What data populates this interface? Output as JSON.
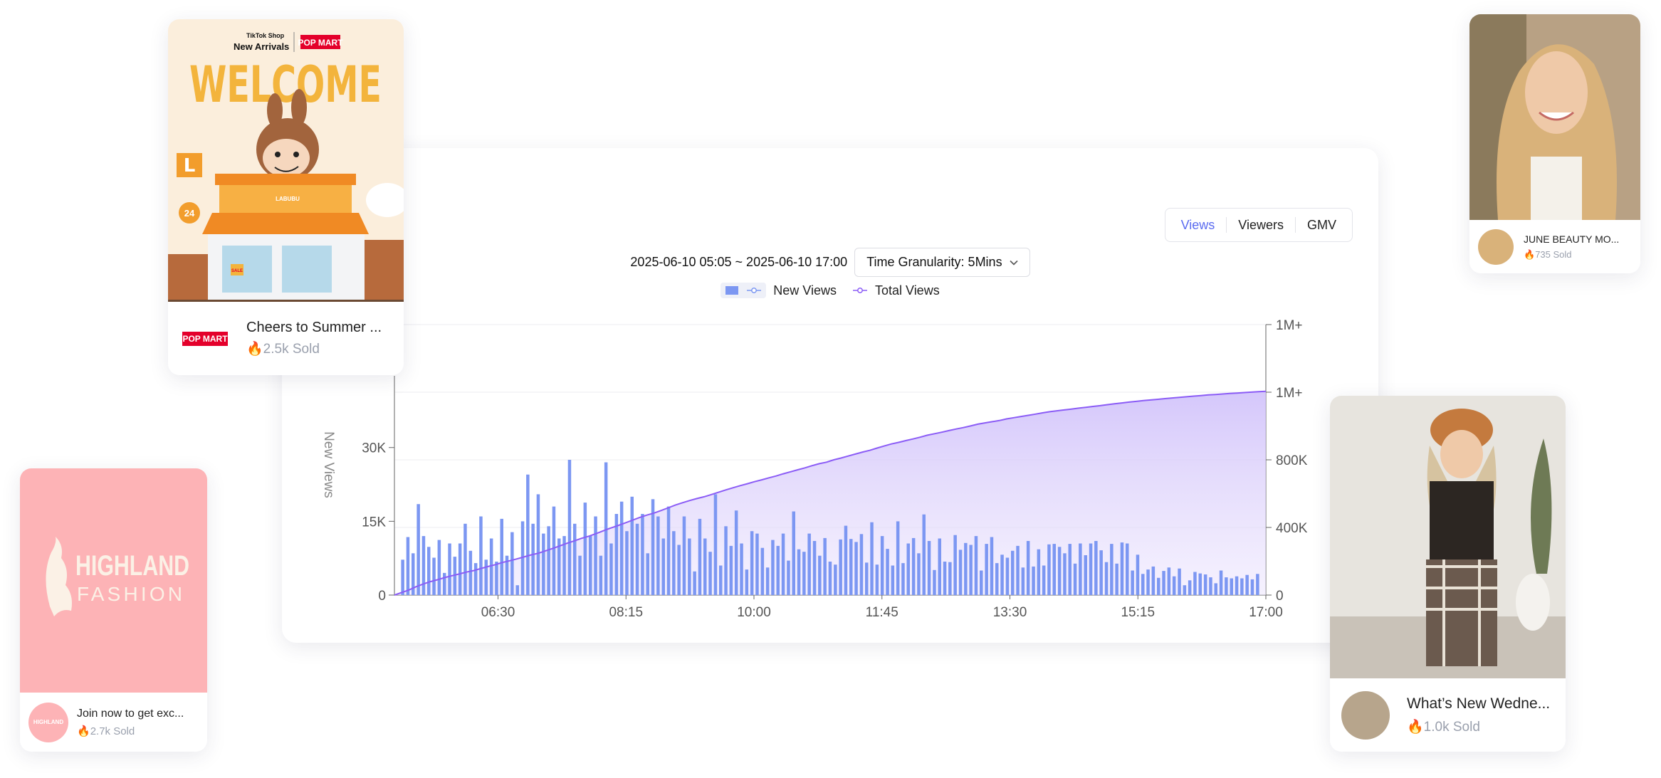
{
  "chart_card": {
    "metric_tabs": [
      "Views",
      "Viewers",
      "GMV"
    ],
    "active_tab": "Views",
    "date_range": "2025-06-10 05:05 ~ 2025-06-10 17:00",
    "granularity_label": "Time Granularity: 5Mins",
    "legend": {
      "bar_label": "New Views",
      "line_label": "Total Views"
    }
  },
  "chart_data": {
    "type": "bar",
    "x_ticks": [
      "06:30",
      "08:15",
      "10:00",
      "11:45",
      "13:30",
      "15:15",
      "17:00"
    ],
    "x_range": [
      "05:05",
      "17:00"
    ],
    "ylabel": "New Views",
    "y_left_ticks": [
      "0",
      "15K",
      "30K"
    ],
    "y_left_range": [
      0,
      55000
    ],
    "y_right_ticks": [
      "0",
      "400K",
      "800K",
      "1M+",
      "1M+"
    ],
    "y_right_range": [
      0,
      1600000
    ],
    "series": [
      {
        "name": "New Views",
        "type": "bar",
        "values": [
          7200,
          11800,
          8500,
          18500,
          12000,
          9800,
          7600,
          11200,
          4500,
          10500,
          7800,
          10500,
          14500,
          9000,
          6500,
          16000,
          7200,
          11500,
          6800,
          15500,
          8000,
          12800,
          2000,
          15000,
          24500,
          14500,
          20500,
          12500,
          14000,
          18000,
          11500,
          12000,
          27500,
          14500,
          8000,
          18800,
          12000,
          16000,
          8000,
          27000,
          10500,
          16500,
          19000,
          13000,
          20000,
          14500,
          16500,
          8500,
          19500,
          16000,
          11500,
          18000,
          13000,
          10200,
          16000,
          11500,
          4800,
          15500,
          11500,
          8800,
          20500,
          6000,
          14000,
          10000,
          17200,
          10500,
          5200,
          13000,
          12500,
          9600,
          5600,
          11200,
          10000,
          12500,
          7000,
          17000,
          9300,
          8800,
          12500,
          11000,
          8000,
          11600,
          6800,
          6200,
          11300,
          14100,
          11400,
          10800,
          12400,
          6600,
          14800,
          6200,
          12000,
          9400,
          6000,
          15000,
          6500,
          10500,
          11600,
          8500,
          16400,
          11000,
          5100,
          11500,
          6800,
          6700,
          12200,
          9200,
          10600,
          10200,
          12000,
          5000,
          10400,
          11800,
          6500,
          8200,
          7600,
          9000,
          10000,
          5600,
          11000,
          5800,
          9300,
          6000,
          10300,
          10400,
          9800,
          8500,
          10400,
          6400,
          10500,
          8100,
          10500,
          11000,
          9100,
          6700,
          10400,
          6400,
          10700,
          10500,
          5000,
          8200,
          4300,
          5200,
          5800,
          3500,
          4900,
          5600,
          3800,
          5400,
          2000,
          3000,
          4700,
          4400,
          4200,
          3600,
          2400,
          5000,
          3600,
          3400,
          3800,
          3400,
          4100,
          3200,
          4300
        ]
      },
      {
        "name": "Total Views",
        "type": "area",
        "values": [
          0,
          15200,
          29700,
          49200,
          65700,
          79600,
          90900,
          103700,
          114500,
          124500,
          135900,
          145000,
          157200,
          169000,
          179800,
          193000,
          203100,
          213900,
          225500,
          237900,
          247500,
          261900,
          276400,
          291500,
          307100,
          320800,
          336000,
          348300,
          363300,
          380200,
          396100,
          410600,
          426200,
          442000,
          458100,
          472500,
          484600,
          499900,
          515600,
          532100,
          546100,
          559100,
          571000,
          581300,
          594600,
          608100,
          621800,
          634700,
          647100,
          658400,
          670700,
          681500,
          693300,
          704500,
          717500,
          729400,
          741100,
          752600,
          765400,
          777400,
          786300,
          800000,
          810600,
          822400,
          834300,
          845700,
          856100,
          869600,
          881500,
          893900,
          903200,
          913500,
          923200,
          934100,
          945700,
          954400,
          963200,
          973100,
          982500,
          990900,
          1000300,
          1011000,
          1018500,
          1025800,
          1032300,
          1042000,
          1049400,
          1056400,
          1063000,
          1070500,
          1077900,
          1084700,
          1089900,
          1095100,
          1100300,
          1105500,
          1110700,
          1115900,
          1120600,
          1126200,
          1131900,
          1136500,
          1141600,
          1145800,
          1150300,
          1154200,
          1158000,
          1161900,
          1166100,
          1169200,
          1173000,
          1176800,
          1180300,
          1184000,
          1186700,
          1189400,
          1192400,
          1195000,
          1198000,
          1200400,
          1202800,
          1205600
        ]
      }
    ]
  },
  "product_cards": [
    {
      "id": "popmart",
      "title": "Cheers to Summer ...",
      "sold": "2.5k Sold",
      "brand": "POP MART",
      "poster_tag": "TikTok Shop",
      "poster_sub": "New Arrivals",
      "poster_brand": "POP MART",
      "poster_headline": "WELCOME",
      "poster_sign": "L",
      "poster_hours": "24",
      "poster_sale": "SALE",
      "poster_store": "LABUBU"
    },
    {
      "id": "highland",
      "title": "Join now to get exc...",
      "sold": "2.7k Sold",
      "logo_line1": "HIGHLAND",
      "logo_line2": "FASHION",
      "avatar_text": "HIGHLAND"
    },
    {
      "id": "june",
      "title": "JUNE BEAUTY MO...",
      "sold": "735 Sold"
    },
    {
      "id": "wednesday",
      "title": "What’s New Wedne...",
      "sold": "1.0k Sold"
    }
  ],
  "colors": {
    "accent": "#5b6cf0",
    "bar": "#7c97f2",
    "area_line": "#8b5cf6",
    "area_fill": "#d9cffb",
    "highland_bg": "#fdb3b6",
    "popmart_red": "#e4002b"
  }
}
